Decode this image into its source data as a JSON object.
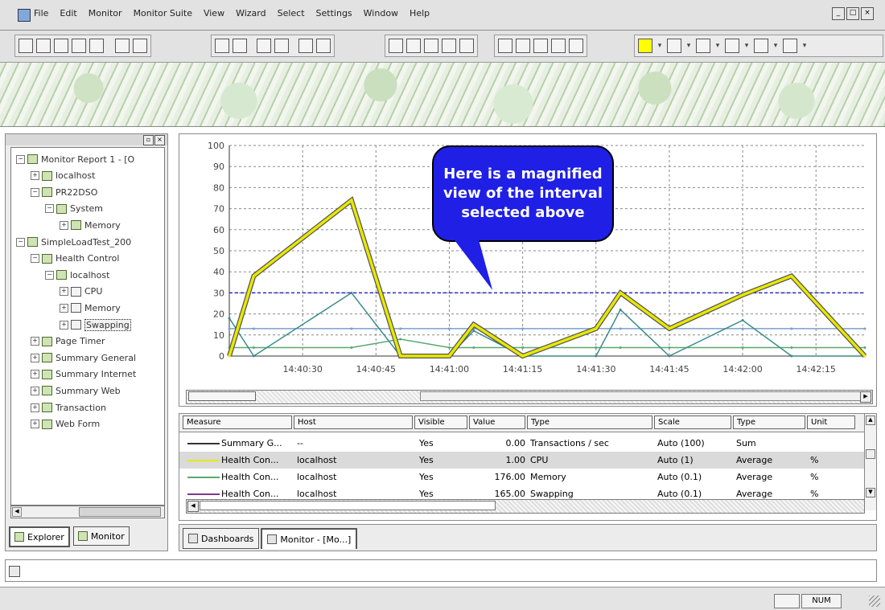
{
  "menu": {
    "items": [
      "File",
      "Edit",
      "Monitor",
      "Monitor Suite",
      "View",
      "Wizard",
      "Select",
      "Settings",
      "Window",
      "Help"
    ],
    "window_controls": [
      "_",
      "□",
      "×"
    ]
  },
  "tree": {
    "items": [
      {
        "label": "Monitor Report 1 - [O",
        "level": 0,
        "expander": "−",
        "icon": "monitor-folder"
      },
      {
        "label": "localhost",
        "level": 1,
        "expander": "+",
        "icon": "host"
      },
      {
        "label": "PR22DSO",
        "level": 1,
        "expander": "−",
        "icon": "host"
      },
      {
        "label": "System",
        "level": 2,
        "expander": "−",
        "icon": "system"
      },
      {
        "label": "Memory",
        "level": 3,
        "expander": "+",
        "icon": "counter"
      },
      {
        "label": "SimpleLoadTest_200",
        "level": 0,
        "expander": "−",
        "icon": "monitor-folder"
      },
      {
        "label": "Health Control",
        "level": 1,
        "expander": "−",
        "icon": "health"
      },
      {
        "label": "localhost",
        "level": 2,
        "expander": "−",
        "icon": "host"
      },
      {
        "label": "CPU",
        "level": 3,
        "expander": "+",
        "icon": "chart"
      },
      {
        "label": "Memory",
        "level": 3,
        "expander": "+",
        "icon": "chart"
      },
      {
        "label": "Swapping",
        "level": 3,
        "expander": "+",
        "icon": "chart",
        "selected": true
      },
      {
        "label": "Page Timer",
        "level": 1,
        "expander": "+",
        "icon": "timer"
      },
      {
        "label": "Summary General",
        "level": 1,
        "expander": "+",
        "icon": "summary"
      },
      {
        "label": "Summary Internet",
        "level": 1,
        "expander": "+",
        "icon": "summary"
      },
      {
        "label": "Summary Web",
        "level": 1,
        "expander": "+",
        "icon": "summary"
      },
      {
        "label": "Transaction",
        "level": 1,
        "expander": "+",
        "icon": "transaction"
      },
      {
        "label": "Web Form",
        "level": 1,
        "expander": "+",
        "icon": "webform"
      }
    ],
    "bottom_tabs": [
      "Explorer",
      "Monitor"
    ]
  },
  "chart_data": {
    "type": "line",
    "title": "",
    "xlabel": "",
    "ylabel": "",
    "ylim": [
      0,
      100
    ],
    "yticks": [
      0,
      10,
      20,
      30,
      40,
      50,
      60,
      70,
      80,
      90,
      100
    ],
    "xticks": [
      "14:40:30",
      "14:40:45",
      "14:41:00",
      "14:41:15",
      "14:41:30",
      "14:41:45",
      "14:42:00",
      "14:42:15"
    ],
    "grid": true,
    "x": [
      "14:40:15",
      "14:40:20",
      "14:40:40",
      "14:40:50",
      "14:41:00",
      "14:41:05",
      "14:41:15",
      "14:41:30",
      "14:41:35",
      "14:41:45",
      "14:42:00",
      "14:42:10",
      "14:42:25"
    ],
    "series": [
      {
        "color": "#e8e800",
        "values": [
          0,
          38,
          74,
          0,
          0,
          15,
          0,
          13,
          30,
          13,
          29,
          38,
          0
        ]
      },
      {
        "color": "#3c8c8c",
        "values": [
          18,
          0,
          30,
          0,
          0,
          12,
          0,
          0,
          22,
          0,
          17,
          0,
          0
        ]
      },
      {
        "color": "#7aa0c8",
        "values": [
          13,
          13,
          13,
          13,
          13,
          13,
          13,
          13,
          13,
          13,
          13,
          13,
          13
        ]
      },
      {
        "color": "#5aa870",
        "values": [
          4,
          4,
          4,
          8,
          4,
          4,
          4,
          4,
          4,
          4,
          4,
          4,
          4
        ]
      }
    ],
    "reference_lines": [
      30
    ]
  },
  "callout": {
    "lines": [
      "Here is a magnified",
      "view of the interval",
      "selected above"
    ]
  },
  "grid": {
    "columns": [
      "Measure",
      "Host",
      "Visible",
      "Value",
      "Type",
      "Scale",
      "Type",
      "Unit"
    ],
    "rows": [
      {
        "measure": "Summary G...",
        "host": "--",
        "visible": "Yes",
        "value": "0.00",
        "type": "Transactions / sec",
        "scale": "Auto (100)",
        "agg": "Sum",
        "unit": "",
        "line_color": "#333333"
      },
      {
        "measure": "Health Con...",
        "host": "localhost",
        "visible": "Yes",
        "value": "1.00",
        "type": "CPU",
        "scale": "Auto (1)",
        "agg": "Average",
        "unit": "%",
        "line_color": "#e8e800",
        "selected": true
      },
      {
        "measure": "Health Con...",
        "host": "localhost",
        "visible": "Yes",
        "value": "176.00",
        "type": "Memory",
        "scale": "Auto (0.1)",
        "agg": "Average",
        "unit": "%",
        "line_color": "#5aa870"
      },
      {
        "measure": "Health Con...",
        "host": "localhost",
        "visible": "Yes",
        "value": "165.00",
        "type": "Swapping",
        "scale": "Auto (0.1)",
        "agg": "Average",
        "unit": "%",
        "line_color": "#7a3a8c"
      }
    ]
  },
  "doc_tabs": [
    "Dashboards",
    "Monitor - [Mo...]"
  ],
  "status": {
    "mode": "NUM"
  }
}
